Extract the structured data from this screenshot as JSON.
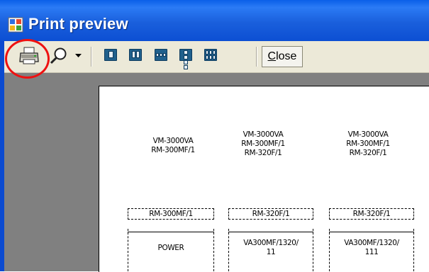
{
  "window": {
    "title": "Print preview"
  },
  "toolbar": {
    "print_icon": "printer-icon",
    "zoom_icon": "magnifier-icon",
    "page_layouts": [
      "one-page",
      "two-pages",
      "three-pages",
      "four-pages",
      "six-pages"
    ],
    "close_label": "Close",
    "close_mnemonic": "C"
  },
  "page": {
    "devices": [
      {
        "lines": [
          "VM-3000VA",
          "RM-300MF/1"
        ]
      },
      {
        "lines": [
          "VM-3000VA",
          "RM-300MF/1",
          "RM-320F/1"
        ]
      },
      {
        "lines": [
          "VM-3000VA",
          "RM-300MF/1",
          "RM-320F/1"
        ]
      }
    ],
    "boxes": [
      {
        "header": "RM-300MF/1",
        "body": [
          "POWER"
        ]
      },
      {
        "header": "RM-320F/1",
        "body": [
          "VA300MF/1320/",
          "11"
        ]
      },
      {
        "header": "RM-320F/1",
        "body": [
          "VA300MF/1320/",
          "111"
        ]
      }
    ]
  },
  "highlight_color": "#ee1111"
}
